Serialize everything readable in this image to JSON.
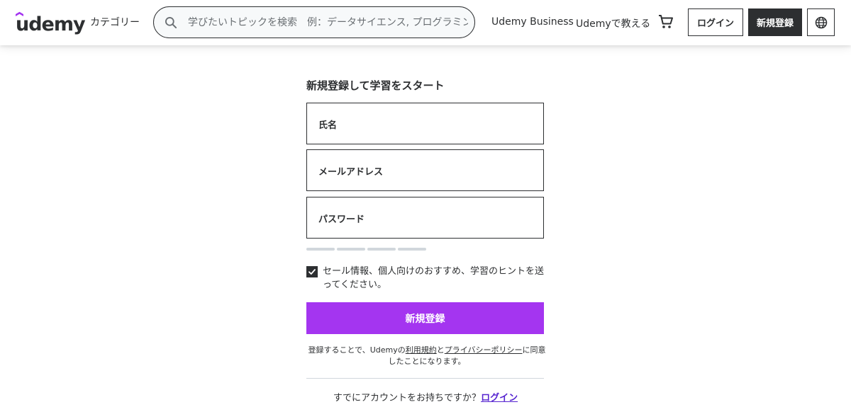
{
  "brand": {
    "logo_text": "udemy",
    "accent": "#a435f0"
  },
  "header": {
    "categories": "カテゴリー",
    "search_placeholder": "学びたいトピックを検索　例：データサイエンス, プログラミン",
    "business_link": "Udemy Business",
    "teach_link": "Udemyで教える",
    "login_button": "ログイン",
    "signup_button": "新規登録",
    "icons": {
      "search": "search-icon",
      "cart": "cart-icon",
      "language": "globe-icon"
    }
  },
  "form": {
    "title": "新規登録して学習をスタート",
    "name_label": "氏名",
    "email_label": "メールアドレス",
    "password_label": "パスワード",
    "checkbox_checked": true,
    "checkbox_text": "セール情報、個人向けのおすすめ、学習のヒントを送ってください。",
    "submit_label": "新規登録",
    "terms_prefix": "登録することで、Udemyの",
    "terms_link": "利用規約",
    "terms_and": "と",
    "privacy_link": "プライバシーポリシー",
    "terms_suffix": "に同意したことになります。",
    "have_account_text": "すでにアカウントをお持ちですか？",
    "login_link": "ログイン"
  }
}
